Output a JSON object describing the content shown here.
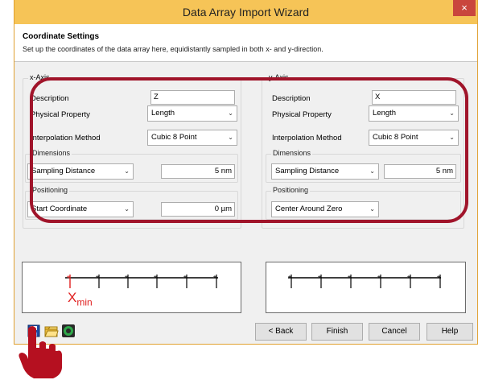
{
  "window": {
    "title": "Data Array Import Wizard",
    "close_label": "×"
  },
  "header": {
    "title": "Coordinate Settings",
    "subtitle": "Set up the coordinates of the data array here, equidistantly sampled in both x- and y-direction."
  },
  "x_axis": {
    "group_title": "x-Axis",
    "description_label": "Description",
    "description_value": "Z",
    "physical_property_label": "Physical Property",
    "physical_property_value": "Length",
    "interpolation_label": "Interpolation Method",
    "interpolation_value": "Cubic 8 Point",
    "dimensions_title": "Dimensions",
    "dimensions_mode": "Sampling Distance",
    "dimensions_value": "5 nm",
    "positioning_title": "Positioning",
    "positioning_mode": "Start Coordinate",
    "positioning_value": "0 µm"
  },
  "y_axis": {
    "group_title": "y-Axis",
    "description_label": "Description",
    "description_value": "X",
    "physical_property_label": "Physical Property",
    "physical_property_value": "Length",
    "interpolation_label": "Interpolation Method",
    "interpolation_value": "Cubic 8 Point",
    "dimensions_title": "Dimensions",
    "dimensions_mode": "Sampling Distance",
    "dimensions_value": "5 nm",
    "positioning_title": "Positioning",
    "positioning_mode": "Center Around Zero"
  },
  "preview": {
    "x_min_main": "X",
    "x_min_sub": "min"
  },
  "buttons": {
    "back": "< Back",
    "finish": "Finish",
    "cancel": "Cancel",
    "help": "Help"
  },
  "icons": [
    "save-icon",
    "open-folder-icon",
    "reset-icon",
    "hand-pointer-icon",
    "dropdown-arrow-icon"
  ],
  "colors": {
    "titlebar": "#f6c457",
    "highlight": "#a0142a",
    "close": "#c9463d",
    "xmin": "#e02020"
  }
}
